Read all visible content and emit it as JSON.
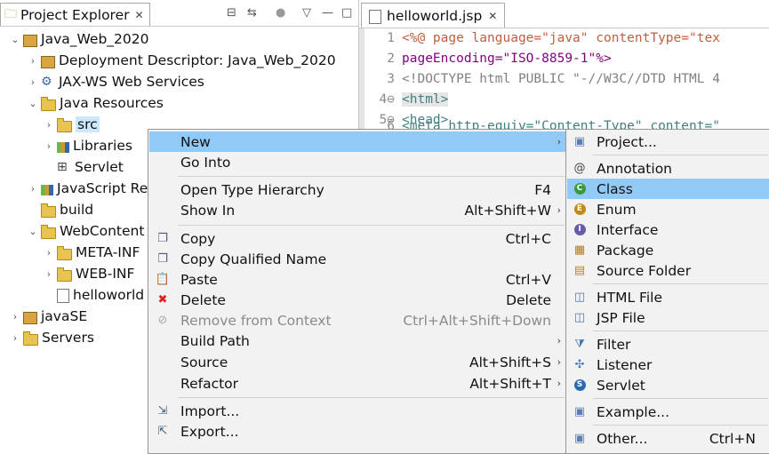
{
  "explorer": {
    "tab_label": "Project Explorer",
    "tree": [
      {
        "id": "r0",
        "label": "Java_Web_2020",
        "chev": "⌄",
        "icon": "project-icon",
        "depth": 0
      },
      {
        "id": "r1",
        "label": "Deployment Descriptor: Java_Web_2020",
        "chev": "›",
        "icon": "deployment-descriptor-icon",
        "depth": 1
      },
      {
        "id": "r2",
        "label": "JAX-WS Web Services",
        "chev": "›",
        "icon": "web-services-icon",
        "depth": 1
      },
      {
        "id": "r3",
        "label": "Java Resources",
        "chev": "⌄",
        "icon": "java-resources-icon",
        "depth": 1
      },
      {
        "id": "r4",
        "label": "src",
        "chev": "›",
        "icon": "source-folder-icon",
        "depth": 2
      },
      {
        "id": "r5",
        "label": "Libraries",
        "chev": "›",
        "icon": "libraries-icon",
        "depth": 2
      },
      {
        "id": "r6",
        "label": "Servlet",
        "chev": "",
        "icon": "servlet-grid-icon",
        "depth": 2
      },
      {
        "id": "r7",
        "label": "JavaScript Re",
        "chev": "›",
        "icon": "javascript-resources-icon",
        "depth": 1
      },
      {
        "id": "r8",
        "label": "build",
        "chev": "",
        "icon": "folder-icon",
        "depth": 1
      },
      {
        "id": "r9",
        "label": "WebContent",
        "chev": "⌄",
        "icon": "folder-icon",
        "depth": 1
      },
      {
        "id": "r10",
        "label": "META-INF",
        "chev": "›",
        "icon": "folder-icon",
        "depth": 2
      },
      {
        "id": "r11",
        "label": "WEB-INF",
        "chev": "›",
        "icon": "folder-icon",
        "depth": 2
      },
      {
        "id": "r12",
        "label": "helloworld",
        "chev": "",
        "icon": "jsp-file-icon",
        "depth": 2
      },
      {
        "id": "r13",
        "label": "javaSE",
        "chev": "›",
        "icon": "project-icon",
        "depth": 0
      },
      {
        "id": "r14",
        "label": "Servers",
        "chev": "›",
        "icon": "folder-icon",
        "depth": 0
      }
    ]
  },
  "editor": {
    "tab_label": "helloworld.jsp",
    "lines": [
      {
        "n": "1",
        "text": "<%@ page language=\"java\" contentType=\"tex"
      },
      {
        "n": "2",
        "text": "    pageEncoding=\"ISO-8859-1\"%>"
      },
      {
        "n": "3",
        "text": "<!DOCTYPE html PUBLIC \"-//W3C//DTD HTML 4"
      },
      {
        "n": "4⊖",
        "text": "<html>"
      },
      {
        "n": "5⊖",
        "text": "<head>"
      },
      {
        "n": "6",
        "text": "<meta http-equiv=\"Content-Type\" content=\""
      }
    ]
  },
  "menu": {
    "items": [
      {
        "label": "New",
        "accel": "",
        "arrow": true,
        "icon": "",
        "hl": true
      },
      {
        "label": "Go Into",
        "accel": "",
        "arrow": false,
        "icon": ""
      },
      {
        "label": "Open Type Hierarchy",
        "accel": "F4",
        "arrow": false,
        "icon": ""
      },
      {
        "label": "Show In",
        "accel": "Alt+Shift+W",
        "arrow": true,
        "icon": ""
      },
      {
        "label": "Copy",
        "accel": "Ctrl+C",
        "arrow": false,
        "icon": "copy-icon"
      },
      {
        "label": "Copy Qualified Name",
        "accel": "",
        "arrow": false,
        "icon": "copy-qualified-icon"
      },
      {
        "label": "Paste",
        "accel": "Ctrl+V",
        "arrow": false,
        "icon": "paste-icon"
      },
      {
        "label": "Delete",
        "accel": "Delete",
        "arrow": false,
        "icon": "delete-icon"
      },
      {
        "label": "Remove from Context",
        "accel": "Ctrl+Alt+Shift+Down",
        "arrow": false,
        "icon": "remove-context-icon",
        "disabled": true
      },
      {
        "label": "Build Path",
        "accel": "",
        "arrow": true,
        "icon": ""
      },
      {
        "label": "Source",
        "accel": "Alt+Shift+S",
        "arrow": true,
        "icon": ""
      },
      {
        "label": "Refactor",
        "accel": "Alt+Shift+T",
        "arrow": true,
        "icon": ""
      },
      {
        "label": "Import...",
        "accel": "",
        "arrow": false,
        "icon": "import-icon"
      },
      {
        "label": "Export...",
        "accel": "",
        "arrow": false,
        "icon": "export-icon"
      }
    ]
  },
  "submenu": {
    "items": [
      {
        "label": "Project...",
        "accel": "",
        "icon": "new-project-icon"
      },
      {
        "label": "Annotation",
        "accel": "",
        "icon": "annotation-icon"
      },
      {
        "label": "Class",
        "accel": "",
        "icon": "class-icon",
        "hl": true
      },
      {
        "label": "Enum",
        "accel": "",
        "icon": "enum-icon"
      },
      {
        "label": "Interface",
        "accel": "",
        "icon": "interface-icon"
      },
      {
        "label": "Package",
        "accel": "",
        "icon": "package-icon"
      },
      {
        "label": "Source Folder",
        "accel": "",
        "icon": "source-folder-icon"
      },
      {
        "label": "HTML File",
        "accel": "",
        "icon": "html-file-icon"
      },
      {
        "label": "JSP File",
        "accel": "",
        "icon": "jsp-file-icon"
      },
      {
        "label": "Filter",
        "accel": "",
        "icon": "filter-icon"
      },
      {
        "label": "Listener",
        "accel": "",
        "icon": "listener-icon"
      },
      {
        "label": "Servlet",
        "accel": "",
        "icon": "servlet-icon"
      },
      {
        "label": "Example...",
        "accel": "",
        "icon": "example-icon"
      },
      {
        "label": "Other...",
        "accel": "Ctrl+N",
        "icon": "other-wizard-icon"
      }
    ]
  },
  "colors": {
    "selection": "#cce8ff",
    "menu_highlight": "#91c9f7",
    "menu_bg": "#f2f2f2"
  }
}
